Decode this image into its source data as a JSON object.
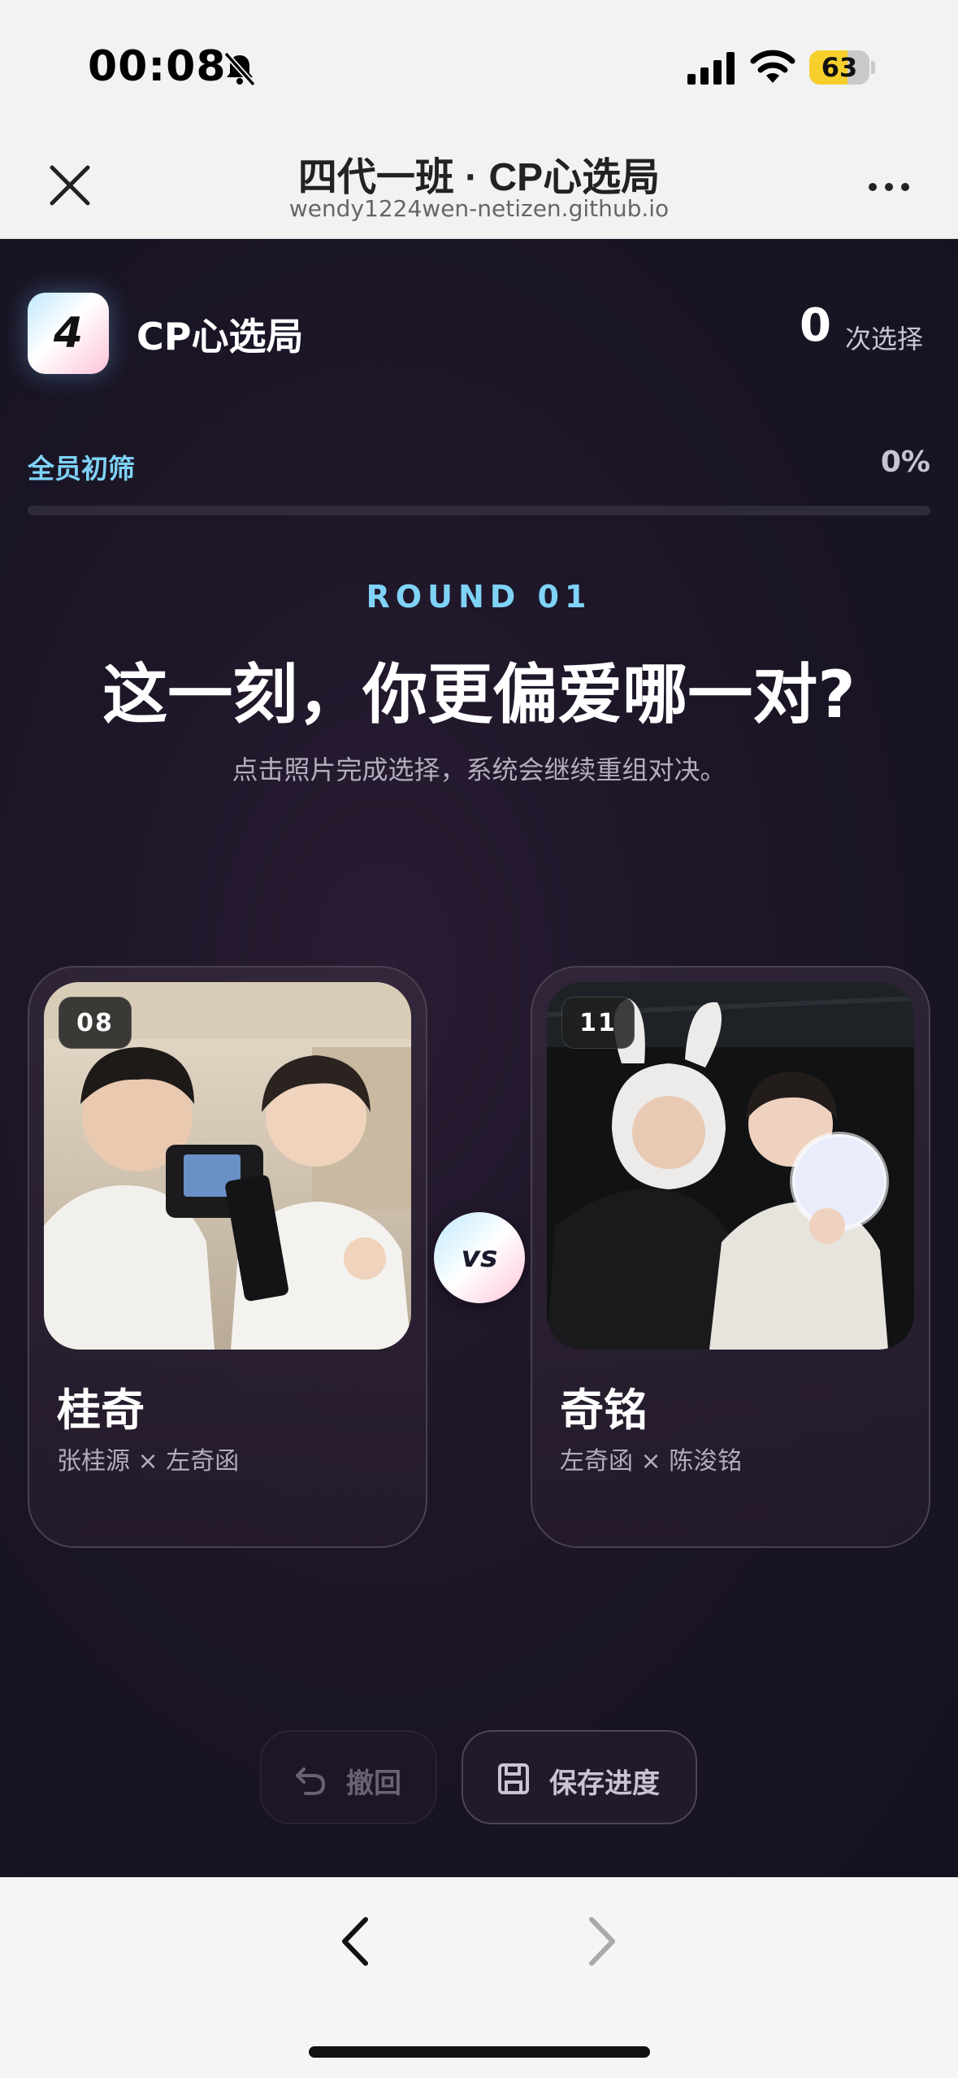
{
  "status_bar": {
    "time": "00:08",
    "battery_level": "63",
    "icons": [
      "bell-slash-icon",
      "cellular-signal-icon",
      "wifi-icon",
      "battery-icon"
    ]
  },
  "browser": {
    "title": "四代一班 · CP心选局",
    "url": "wendy1224wen-netizen.github.io",
    "icons": [
      "close-icon",
      "more-icon",
      "back-arrow-icon",
      "forward-arrow-icon"
    ]
  },
  "app": {
    "logo_text": "4",
    "name": "CP心选局",
    "choice_count": "0",
    "choice_count_label": "次选择",
    "stage_label": "全员初筛",
    "progress_text": "0%",
    "progress": 0,
    "round_label": "ROUND 01",
    "question": "这一刻，你更偏爱哪一对?",
    "hint": "点击照片完成选择，系统会继续重组对决。",
    "vs_label": "vs",
    "accent_color": "#7fd3f7",
    "pink_color": "#ffc3d9"
  },
  "cards": [
    {
      "badge": "08",
      "name": "桂奇",
      "members": "张桂源 × 左奇函"
    },
    {
      "badge": "11",
      "name": "奇铭",
      "members": "左奇函 × 陈浚铭"
    }
  ],
  "actions": {
    "undo_label": "撤回",
    "save_label": "保存进度"
  }
}
